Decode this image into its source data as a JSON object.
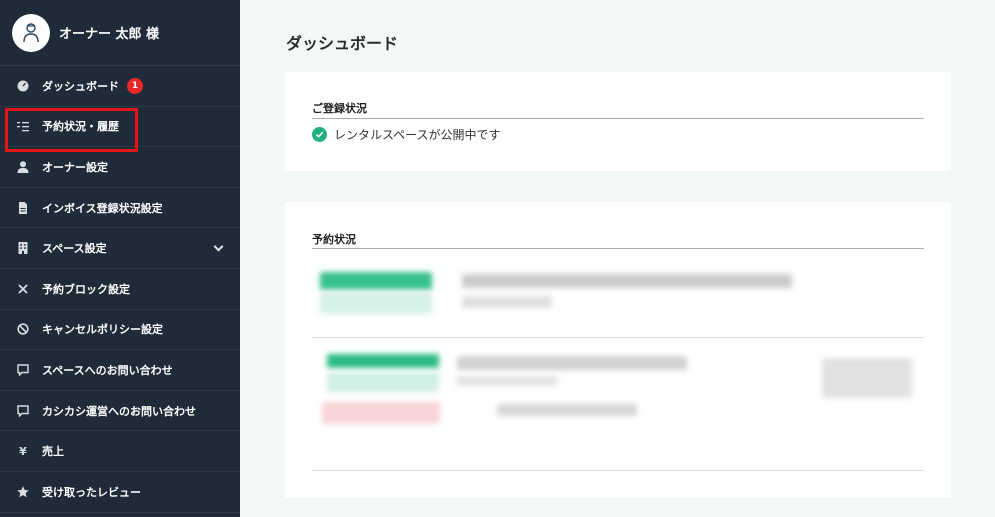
{
  "sidebar": {
    "owner_name": "オーナー 太郎 様",
    "items": [
      {
        "label": "ダッシュボード",
        "icon": "gauge-icon",
        "badge": "1"
      },
      {
        "label": "予約状況・履歴",
        "icon": "list-check-icon"
      },
      {
        "label": "オーナー設定",
        "icon": "user-icon"
      },
      {
        "label": "インボイス登録状況設定",
        "icon": "document-icon"
      },
      {
        "label": "スペース設定",
        "icon": "building-icon"
      },
      {
        "label": "予約ブロック設定",
        "icon": "x-icon"
      },
      {
        "label": "キャンセルポリシー設定",
        "icon": "ban-icon"
      },
      {
        "label": "スペースへのお問い合わせ",
        "icon": "chat-icon"
      },
      {
        "label": "カシカシ運営へのお問い合わせ",
        "icon": "chat-icon"
      },
      {
        "label": "売上",
        "icon": "yen-icon"
      },
      {
        "label": "受け取ったレビュー",
        "icon": "star-icon"
      }
    ]
  },
  "main": {
    "title": "ダッシュボード",
    "registration": {
      "heading": "ご登録状況",
      "status": "レンタルスペースが公開中です"
    },
    "reservations": {
      "heading": "予約状況"
    }
  },
  "colors": {
    "sidebar_bg": "#1f2b38",
    "accent_green": "#22b07d",
    "badge_red": "#e8272b",
    "highlight_red": "#e5141a",
    "page_bg": "#f1f8f5"
  }
}
